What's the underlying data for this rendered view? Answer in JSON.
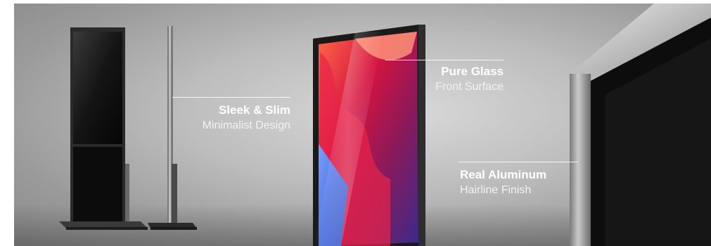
{
  "features": [
    {
      "title": "Sleek & Slim",
      "subtitle": "Minimalist Design"
    },
    {
      "title": "Pure Glass",
      "subtitle": "Front Surface"
    },
    {
      "title": "Real Aluminum",
      "subtitle": "Hairline Finish"
    }
  ],
  "colors": {
    "background": "#b5b5b5",
    "screen_bezel": "#1a1a1a",
    "label_text": "#ffffff",
    "screen_accent_red": "#c8123a",
    "screen_accent_blue": "#4a6fd6"
  }
}
